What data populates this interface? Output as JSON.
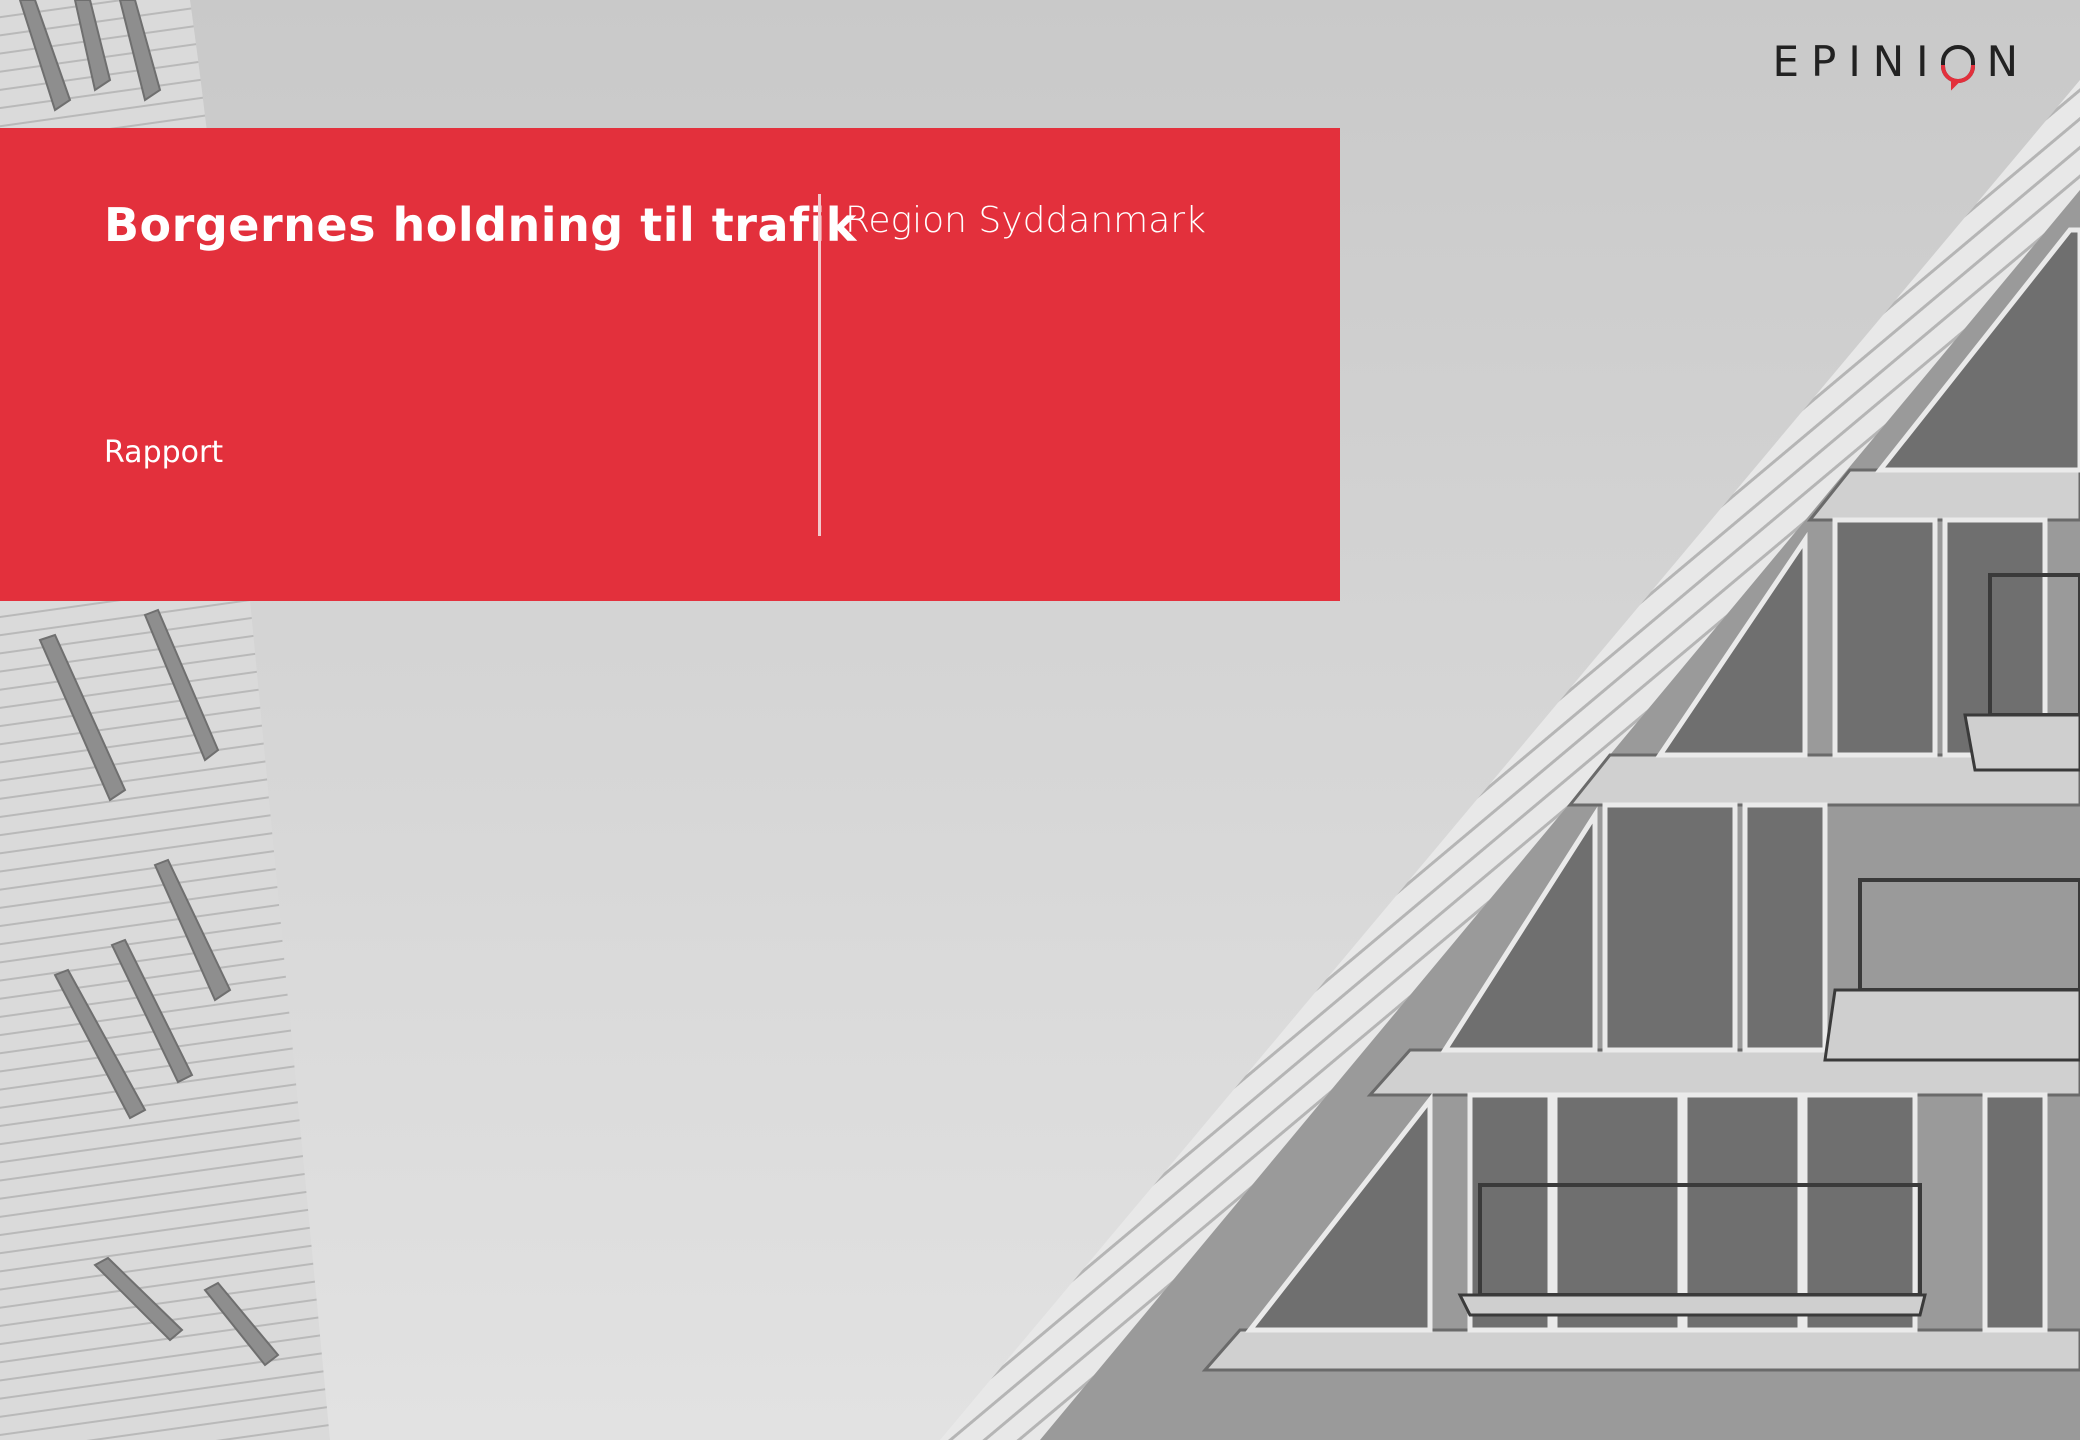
{
  "brand": {
    "logo_text_pre": "EPINI",
    "logo_text_post": "N",
    "accent_color": "#e3303c"
  },
  "cover": {
    "title": "Borgernes holdning til trafik",
    "region": "Region Syddanmark",
    "document_type": "Rapport"
  },
  "background": {
    "description_icon": "building-photo-grayscale"
  }
}
